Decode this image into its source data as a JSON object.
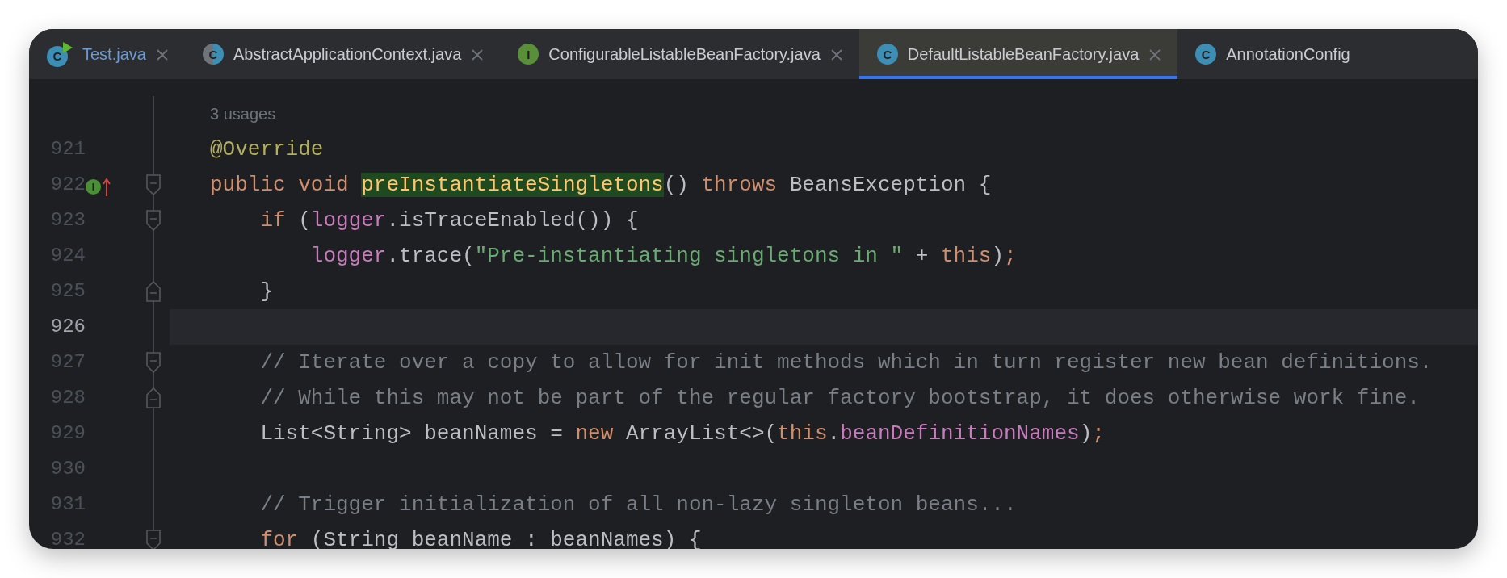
{
  "tabs": [
    {
      "label": "Test.java",
      "selected": false,
      "modified": true,
      "closable": true,
      "icon": {
        "letter": "C",
        "kind": "class-run"
      }
    },
    {
      "label": "AbstractApplicationContext.java",
      "selected": false,
      "modified": false,
      "closable": true,
      "icon": {
        "letter": "C",
        "kind": "abstract"
      }
    },
    {
      "label": "ConfigurableListableBeanFactory.java",
      "selected": false,
      "modified": false,
      "closable": true,
      "icon": {
        "letter": "I",
        "kind": "interface"
      }
    },
    {
      "label": "DefaultListableBeanFactory.java",
      "selected": true,
      "modified": false,
      "closable": true,
      "icon": {
        "letter": "C",
        "kind": "class"
      }
    },
    {
      "label": "AnnotationConfig",
      "selected": false,
      "modified": false,
      "closable": false,
      "icon": {
        "letter": "C",
        "kind": "class"
      }
    }
  ],
  "editor": {
    "lines": [
      {
        "kind": "hint",
        "text": "3 usages",
        "current": false
      },
      {
        "kind": "code",
        "number": "921",
        "current": false,
        "tokens": [
          {
            "kind": "annotation",
            "text": "@Override"
          }
        ]
      },
      {
        "kind": "code",
        "number": "922",
        "current": false,
        "fold": {
          "kind": "start"
        },
        "gutter_mark": {
          "letter": "I",
          "kind": "implements"
        },
        "tokens": [
          {
            "kind": "keyword",
            "text": "public void "
          },
          {
            "kind": "declaration",
            "text": "preInstantiateSingletons"
          },
          {
            "kind": "plain",
            "text": "() "
          },
          {
            "kind": "keyword",
            "text": "throws"
          },
          {
            "kind": "plain",
            "text": " BeansException {"
          }
        ],
        "children": [
          {
            "kind": "code",
            "number": "923",
            "current": false,
            "fold": {
              "kind": "start"
            },
            "tokens": [
              {
                "kind": "keyword",
                "text": "if"
              },
              {
                "kind": "plain",
                "text": " ("
              },
              {
                "kind": "field",
                "text": "logger"
              },
              {
                "kind": "plain",
                "text": ".isTraceEnabled()) {"
              }
            ],
            "children": [
              {
                "kind": "code",
                "number": "924",
                "current": false,
                "tokens": [
                  {
                    "kind": "field",
                    "text": "logger"
                  },
                  {
                    "kind": "plain",
                    "text": ".trace("
                  },
                  {
                    "kind": "string",
                    "text": "\"Pre-instantiating singletons in \""
                  },
                  {
                    "kind": "plain",
                    "text": " + "
                  },
                  {
                    "kind": "keyword",
                    "text": "this"
                  },
                  {
                    "kind": "plain",
                    "text": ")"
                  },
                  {
                    "kind": "keyword",
                    "text": ";"
                  }
                ]
              }
            ]
          },
          {
            "kind": "code",
            "number": "925",
            "current": false,
            "fold": {
              "kind": "end"
            },
            "tokens": [
              {
                "kind": "plain",
                "text": "}"
              }
            ]
          },
          {
            "kind": "code",
            "number": "926",
            "current": true
          },
          {
            "kind": "code",
            "number": "927",
            "current": false,
            "fold": {
              "kind": "start"
            },
            "tokens": [
              {
                "kind": "comment",
                "text": "// Iterate over a copy to allow for init methods which in turn register new bean definitions."
              }
            ]
          },
          {
            "kind": "code",
            "number": "928",
            "current": false,
            "fold": {
              "kind": "end"
            },
            "tokens": [
              {
                "kind": "comment",
                "text": "// While this may not be part of the regular factory bootstrap, it does otherwise work fine."
              }
            ]
          },
          {
            "kind": "code",
            "number": "929",
            "current": false,
            "tokens": [
              {
                "kind": "plain",
                "text": "List<String> beanNames = "
              },
              {
                "kind": "keyword",
                "text": "new"
              },
              {
                "kind": "plain",
                "text": " ArrayList<>("
              },
              {
                "kind": "keyword",
                "text": "this"
              },
              {
                "kind": "plain",
                "text": "."
              },
              {
                "kind": "field",
                "text": "beanDefinitionNames"
              },
              {
                "kind": "plain",
                "text": ")"
              },
              {
                "kind": "keyword",
                "text": ";"
              }
            ]
          },
          {
            "kind": "code",
            "number": "930",
            "current": false
          },
          {
            "kind": "code",
            "number": "931",
            "current": false,
            "tokens": [
              {
                "kind": "comment",
                "text": "// Trigger initialization of all non-lazy singleton beans..."
              }
            ]
          },
          {
            "kind": "code",
            "number": "932",
            "current": false,
            "fold": {
              "kind": "start"
            },
            "tokens": [
              {
                "kind": "keyword",
                "text": "for"
              },
              {
                "kind": "plain",
                "text": " (String beanName : beanNames) {"
              }
            ]
          }
        ]
      }
    ]
  }
}
